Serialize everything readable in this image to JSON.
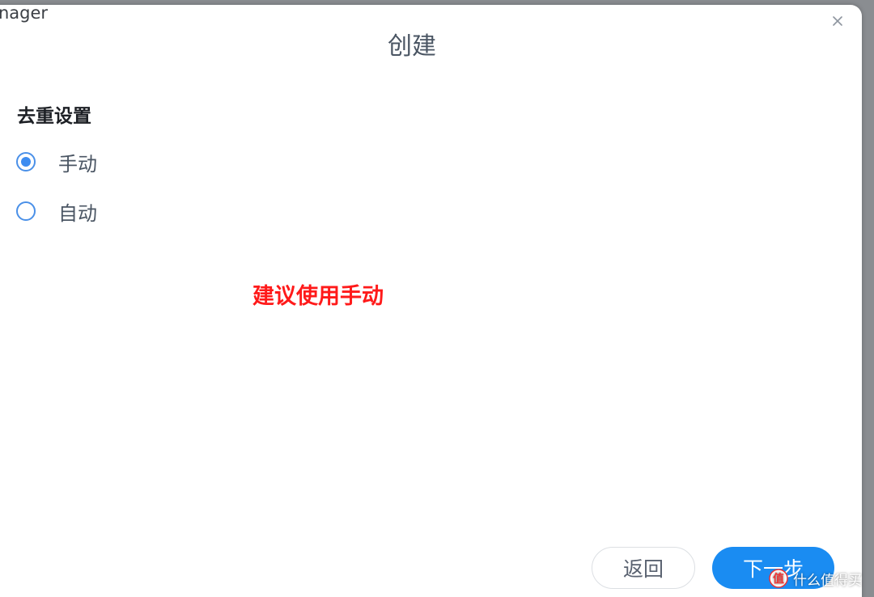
{
  "app": {
    "title_fragment": "nager"
  },
  "dialog": {
    "title": "创建",
    "close_icon": "close-icon"
  },
  "dedup_settings": {
    "heading": "去重设置",
    "options": [
      {
        "label": "手动",
        "selected": true
      },
      {
        "label": "自动",
        "selected": false
      }
    ]
  },
  "annotation": {
    "text": "建议使用手动",
    "color": "#ff1a1a"
  },
  "footer": {
    "back_label": "返回",
    "next_label": "下一步"
  },
  "watermark": {
    "text": "什么值得买",
    "logo": "smzdm-logo-icon"
  },
  "colors": {
    "accent": "#1a8cf2",
    "radio": "#3d8cf0",
    "annotation": "#ff1a1a"
  }
}
